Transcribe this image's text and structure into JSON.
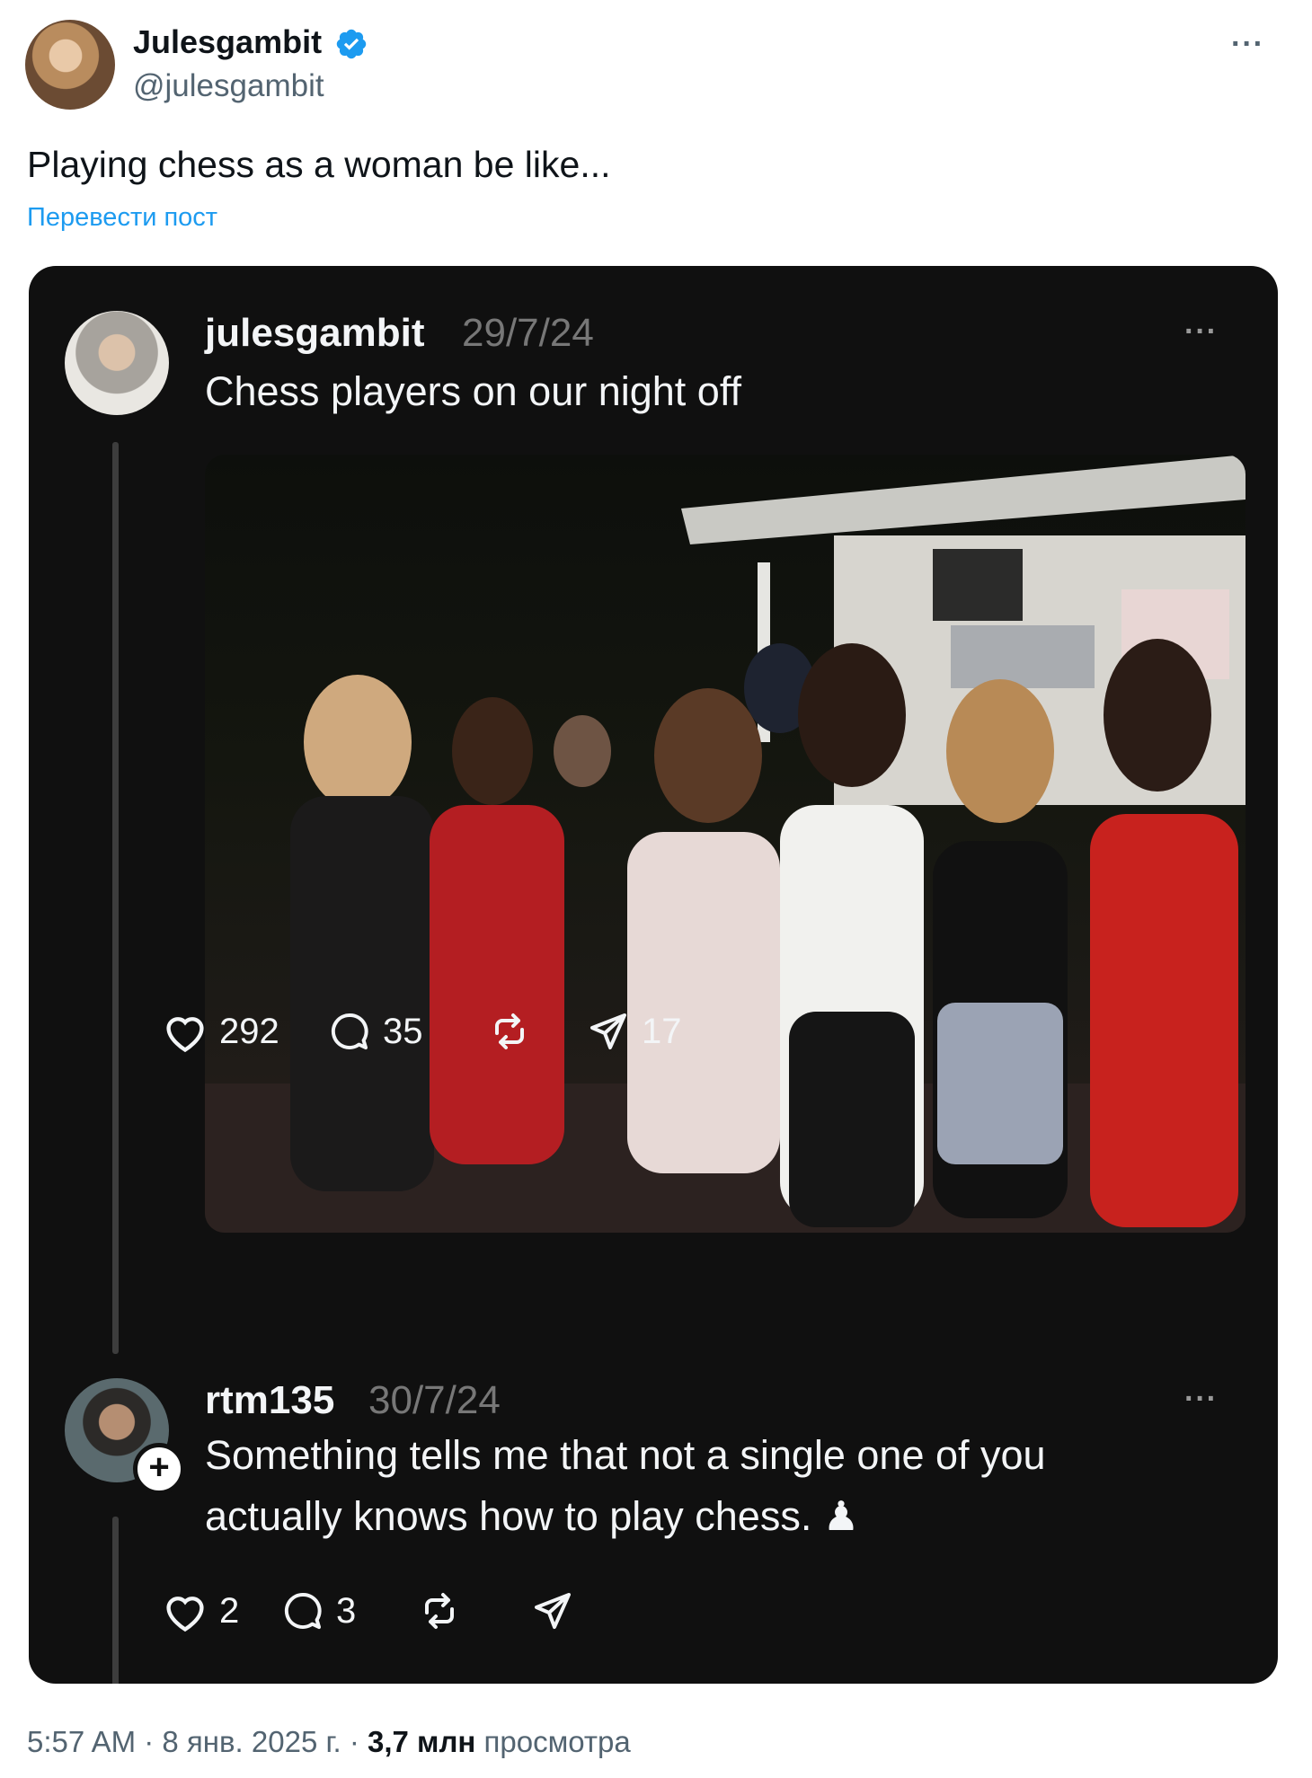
{
  "post": {
    "display_name": "Julesgambit",
    "handle": "@julesgambit",
    "text": "Playing chess as a woman be like...",
    "translate_label": "Перевести пост",
    "more_label": "···"
  },
  "embedded": {
    "original": {
      "username": "julesgambit",
      "date": "29/7/24",
      "text": "Chess players on our night off",
      "more_label": "···",
      "likes": "292",
      "replies": "35",
      "shares": "17"
    },
    "reply": {
      "username": "rtm135",
      "date": "30/7/24",
      "text_line1": "Something tells me that not a single one of you",
      "text_line2": "actually knows how to play chess. ♟",
      "more_label": "···",
      "likes": "2",
      "replies": "3",
      "follow_label": "+"
    }
  },
  "footer": {
    "time": "5:57 AM",
    "sep1": " · ",
    "date": "8 янв. 2025 г.",
    "sep2": " · ",
    "views_count": "3,7 млн",
    "views_label": " просмотра"
  },
  "colors": {
    "accent": "#1d9bf0",
    "card_bg": "#101010",
    "muted": "#536471"
  }
}
